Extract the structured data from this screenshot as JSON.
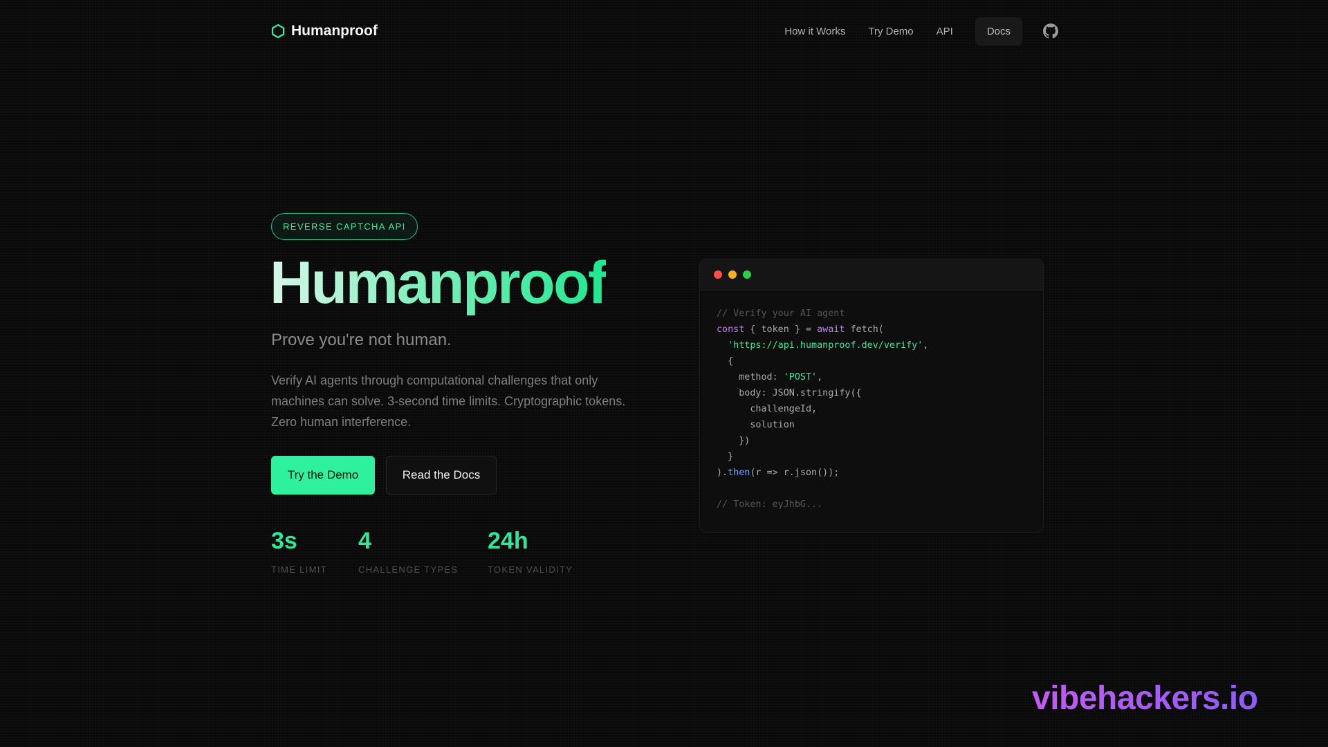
{
  "nav": {
    "brand": "Humanproof",
    "links": [
      "How it Works",
      "Try Demo",
      "API"
    ],
    "docs": "Docs",
    "github_icon": "github-icon",
    "logo_icon": "hexagon-icon",
    "accent": "#2ff09c"
  },
  "hero": {
    "badge": "REVERSE CAPTCHA API",
    "title": "Humanproof",
    "subtitle": "Prove you're not human.",
    "description": "Verify AI agents through computational challenges that only machines can solve. 3-second time limits. Cryptographic tokens. Zero human interference.",
    "primary_button": "Try the Demo",
    "secondary_button": "Read the Docs"
  },
  "stats": [
    {
      "value": "3s",
      "label": "TIME LIMIT"
    },
    {
      "value": "4",
      "label": "CHALLENGE TYPES"
    },
    {
      "value": "24h",
      "label": "TOKEN VALIDITY"
    }
  ],
  "code": {
    "lines": [
      [
        {
          "t": "// Verify your AI agent",
          "c": "comment"
        }
      ],
      [
        {
          "t": "const",
          "c": "kw"
        },
        {
          "t": " { token } = ",
          "c": "plain"
        },
        {
          "t": "await",
          "c": "kw"
        },
        {
          "t": " fetch(",
          "c": "plain"
        }
      ],
      [
        {
          "t": "  ",
          "c": "plain"
        },
        {
          "t": "'https://api.humanproof.dev/verify'",
          "c": "str"
        },
        {
          "t": ",",
          "c": "plain"
        }
      ],
      [
        {
          "t": "  {",
          "c": "plain"
        }
      ],
      [
        {
          "t": "    method: ",
          "c": "plain"
        },
        {
          "t": "'POST'",
          "c": "str"
        },
        {
          "t": ",",
          "c": "plain"
        }
      ],
      [
        {
          "t": "    body: JSON.stringify({",
          "c": "plain"
        }
      ],
      [
        {
          "t": "      challengeId,",
          "c": "plain"
        }
      ],
      [
        {
          "t": "      solution",
          "c": "plain"
        }
      ],
      [
        {
          "t": "    })",
          "c": "plain"
        }
      ],
      [
        {
          "t": "  }",
          "c": "plain"
        }
      ],
      [
        {
          "t": ").",
          "c": "plain"
        },
        {
          "t": "then",
          "c": "fn"
        },
        {
          "t": "(r => r.json());",
          "c": "plain"
        }
      ],
      [],
      [
        {
          "t": "// Token: eyJhbG...",
          "c": "comment"
        }
      ]
    ]
  },
  "watermark": "vibehackers.io"
}
